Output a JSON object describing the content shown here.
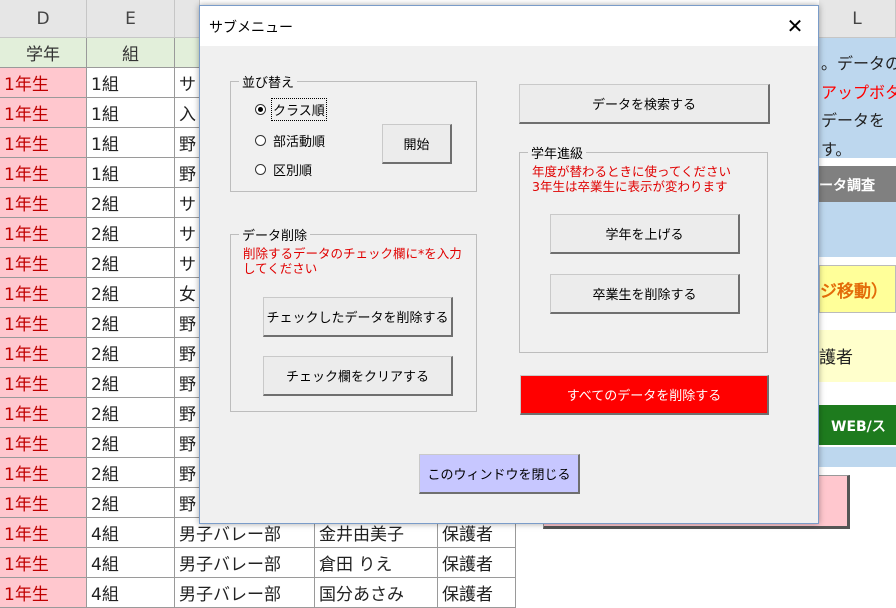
{
  "sheet": {
    "col_letters": {
      "d": "D",
      "e": "E",
      "l": "L"
    },
    "header_row": {
      "grade": "学年",
      "class": "組"
    },
    "rows": [
      {
        "grade": "1年生",
        "class": "1組",
        "club": "サ",
        "name": "",
        "role": ""
      },
      {
        "grade": "1年生",
        "class": "1組",
        "club": "入",
        "name": "",
        "role": ""
      },
      {
        "grade": "1年生",
        "class": "1組",
        "club": "野",
        "name": "",
        "role": ""
      },
      {
        "grade": "1年生",
        "class": "1組",
        "club": "野",
        "name": "",
        "role": ""
      },
      {
        "grade": "1年生",
        "class": "2組",
        "club": "サ",
        "name": "",
        "role": ""
      },
      {
        "grade": "1年生",
        "class": "2組",
        "club": "サ",
        "name": "",
        "role": ""
      },
      {
        "grade": "1年生",
        "class": "2組",
        "club": "サ",
        "name": "",
        "role": ""
      },
      {
        "grade": "1年生",
        "class": "2組",
        "club": "女",
        "name": "",
        "role": ""
      },
      {
        "grade": "1年生",
        "class": "2組",
        "club": "野",
        "name": "",
        "role": ""
      },
      {
        "grade": "1年生",
        "class": "2組",
        "club": "野",
        "name": "",
        "role": ""
      },
      {
        "grade": "1年生",
        "class": "2組",
        "club": "野",
        "name": "",
        "role": ""
      },
      {
        "grade": "1年生",
        "class": "2組",
        "club": "野",
        "name": "",
        "role": ""
      },
      {
        "grade": "1年生",
        "class": "2組",
        "club": "野",
        "name": "",
        "role": ""
      },
      {
        "grade": "1年生",
        "class": "2組",
        "club": "野",
        "name": "",
        "role": ""
      },
      {
        "grade": "1年生",
        "class": "2組",
        "club": "野",
        "name": "",
        "role": ""
      },
      {
        "grade": "1年生",
        "class": "4組",
        "club": "男子バレー部",
        "name": "金井由美子",
        "role": "保護者"
      },
      {
        "grade": "1年生",
        "class": "4組",
        "club": "男子バレー部",
        "name": "倉田 りえ",
        "role": "保護者"
      },
      {
        "grade": "1年生",
        "class": "4組",
        "club": "男子バレー部",
        "name": "国分あさみ",
        "role": "保護者"
      }
    ],
    "right_panel": {
      "info_line1": "。データの",
      "info_line2": "アップボタ",
      "info_line3": "データを",
      "info_line4": "す。",
      "survey_btn": "ータ調査",
      "move_btn": "ジ移動）",
      "guardian_label": "護者",
      "web_btn": "WEB/ス"
    }
  },
  "dialog": {
    "title": "サブメニュー",
    "close_glyph": "✕",
    "sort": {
      "label": "並び替え",
      "options": [
        "クラス順",
        "部活動順",
        "区別順"
      ],
      "selected_index": 0,
      "start_button": "開始"
    },
    "delete": {
      "label": "データ削除",
      "note_line1": "削除するデータのチェック欄に*を入力",
      "note_line2": "してください",
      "delete_checked_button": "チェックしたデータを削除する",
      "clear_checks_button": "チェック欄をクリアする"
    },
    "search_button": "データを検索する",
    "grade": {
      "label": "学年進級",
      "note_line1": "年度が替わるときに使ってください",
      "note_line2": "3年生は卒業生に表示が変わります",
      "raise_button": "学年を上げる",
      "delete_grads_button": "卒業生を削除する"
    },
    "delete_all_button": "すべてのデータを削除する",
    "close_window_button": "このウィンドウを閉じる"
  },
  "colors": {
    "grade_cell_bg": "#ffc7ce",
    "grade_cell_text": "#c00000",
    "header_cell_bg": "#e2efda",
    "info_panel_bg": "#bdd7ee",
    "delete_all_bg": "#ff0000",
    "close_window_bg": "#c7c7ff",
    "note_text": "#e00000"
  }
}
